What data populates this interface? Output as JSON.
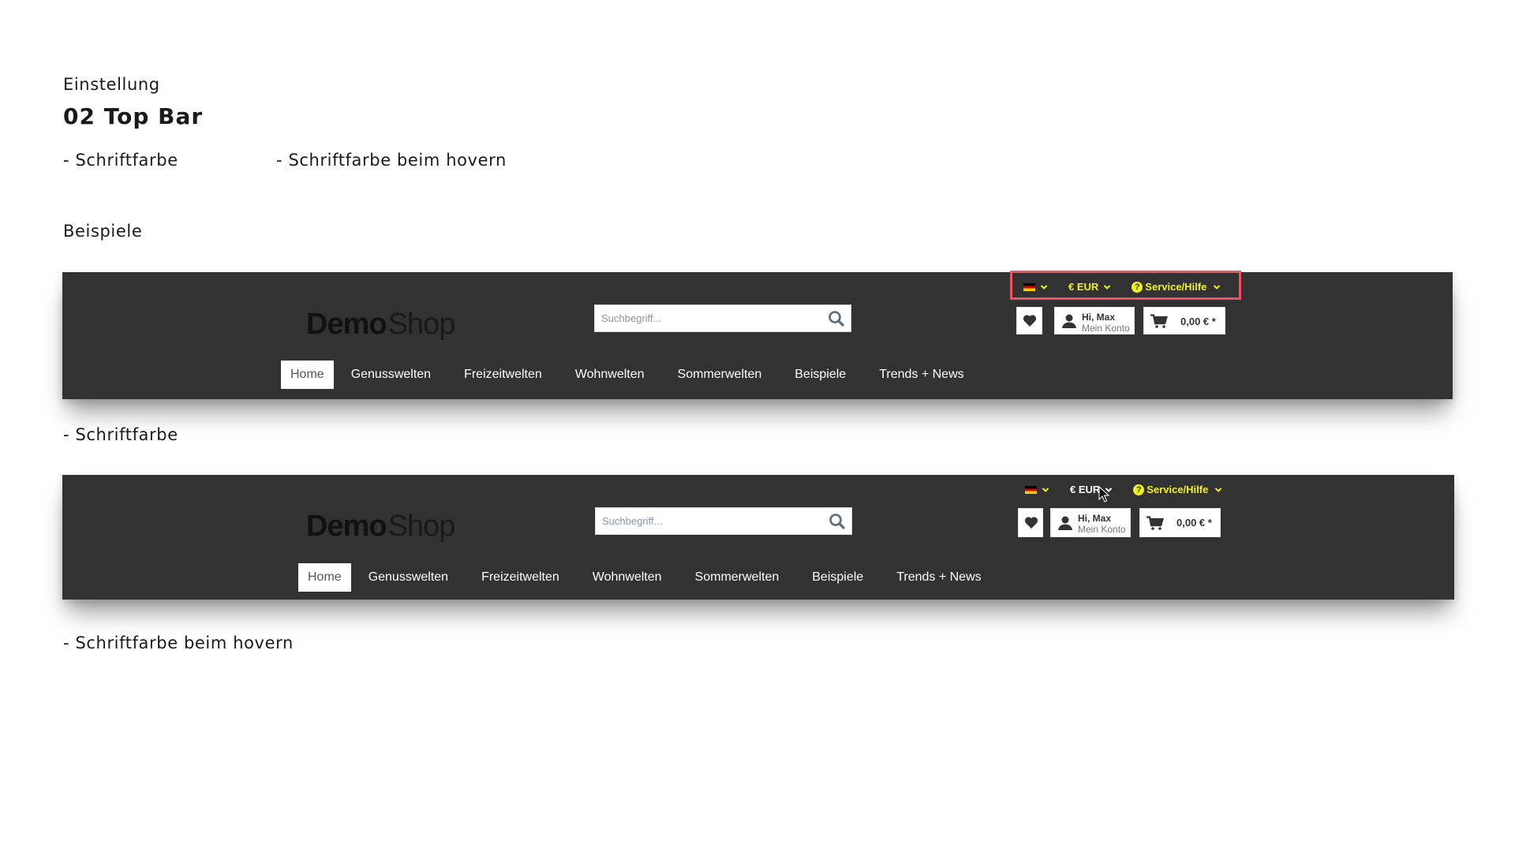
{
  "doc": {
    "section_label": "Einstellung",
    "title": "02 Top Bar",
    "settings": [
      "- Schriftfarbe",
      "- Schriftfarbe beim hovern"
    ],
    "examples_label": "Beispiele",
    "caption_1": "- Schriftfarbe",
    "caption_2": "- Schriftfarbe beim hovern"
  },
  "colors": {
    "bar_bg": "#323232",
    "topbar_text": "#f0f01e",
    "topbar_hover_text": "#ffffff",
    "highlight_border": "#ec5461"
  },
  "example_1": {
    "logo_bold": "Demo",
    "logo_light": "Shop",
    "search_placeholder": "Suchbegriff...",
    "topbar": {
      "language": "de",
      "currency": "€ EUR",
      "service": "Service/Hilfe"
    },
    "account_greeting": "Hi, Max",
    "account_label": "Mein Konto",
    "cart_total": "0,00 € *",
    "nav": [
      "Home",
      "Genusswelten",
      "Freizeitwelten",
      "Wohnwelten",
      "Sommerwelten",
      "Beispiele",
      "Trends + News"
    ],
    "active_nav": "Home"
  },
  "example_2": {
    "logo_bold": "Demo",
    "logo_light": "Shop",
    "search_placeholder": "Suchbegriff...",
    "topbar": {
      "language": "de",
      "currency": "€ EUR",
      "service": "Service/Hilfe",
      "hovered": "currency"
    },
    "account_greeting": "Hi, Max",
    "account_label": "Mein Konto",
    "cart_total": "0,00 € *",
    "nav": [
      "Home",
      "Genusswelten",
      "Freizeitwelten",
      "Wohnwelten",
      "Sommerwelten",
      "Beispiele",
      "Trends + News"
    ],
    "active_nav": "Home"
  }
}
